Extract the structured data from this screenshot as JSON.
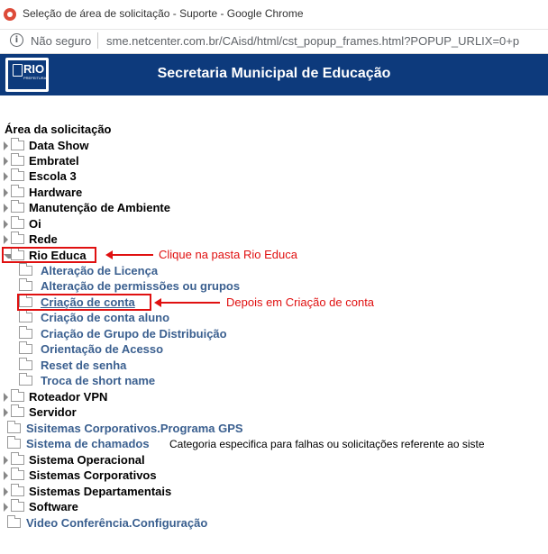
{
  "window": {
    "title": "Seleção de área de solicitação - Suporte - Google Chrome"
  },
  "address": {
    "security": "Não seguro",
    "url": "sme.netcenter.com.br/CAisd/html/cst_popup_frames.html?POPUP_URLIX=0+p"
  },
  "header": {
    "logo_text": "RIO",
    "logo_sub": "PREFEITURA",
    "title": "Secretaria Municipal de Educação"
  },
  "tree": {
    "heading": "Área da solicitação",
    "items": [
      {
        "label": "Data Show"
      },
      {
        "label": "Embratel"
      },
      {
        "label": "Escola 3"
      },
      {
        "label": "Hardware"
      },
      {
        "label": "Manutenção de Ambiente"
      },
      {
        "label": "Oi"
      },
      {
        "label": "Rede"
      },
      {
        "label": "Rio Educa"
      },
      {
        "label": "Alteração de Licença"
      },
      {
        "label": "Alteração de permissões ou grupos"
      },
      {
        "label": "Criação de conta"
      },
      {
        "label": "Criação de conta aluno"
      },
      {
        "label": "Criação de Grupo de Distribuição"
      },
      {
        "label": "Orientação de Acesso"
      },
      {
        "label": "Reset de senha"
      },
      {
        "label": "Troca de short name"
      },
      {
        "label": "Roteador VPN"
      },
      {
        "label": "Servidor"
      },
      {
        "label": "Sisitemas Corporativos.Programa GPS"
      },
      {
        "label": "Sistema de chamados",
        "description": "Categoria especifica para falhas ou solicitações referente ao siste"
      },
      {
        "label": "Sistema Operacional"
      },
      {
        "label": "Sistemas Corporativos"
      },
      {
        "label": "Sistemas Departamentais"
      },
      {
        "label": "Software"
      },
      {
        "label": "Video Conferência.Configuração"
      }
    ]
  },
  "annotations": {
    "rio_educa_note": "Clique na pasta Rio Educa",
    "criacao_note": "Depois em Criação de conta"
  },
  "colors": {
    "header_bg": "#0d3a7c",
    "link": "#3a5f8f",
    "annotation": "#e01010"
  }
}
